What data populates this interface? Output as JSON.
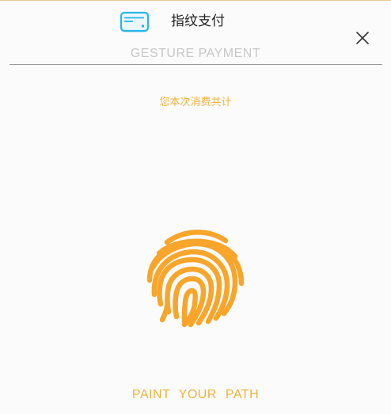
{
  "header": {
    "title": "指纹支付",
    "subtitle": "GESTURE PAYMENT",
    "card_icon": "credit-card-icon",
    "close_icon": "close-icon"
  },
  "main": {
    "amount_label": "您本次消费共计",
    "fingerprint_icon": "fingerprint-icon",
    "prompt": "PAINT YOUR PATH"
  },
  "colors": {
    "accent": "#f3b23c",
    "fingerprint": "#f7a52b",
    "card_icon": "#27b6e8",
    "subtitle": "#c7c7c7",
    "divider": "#9a9a9a"
  }
}
